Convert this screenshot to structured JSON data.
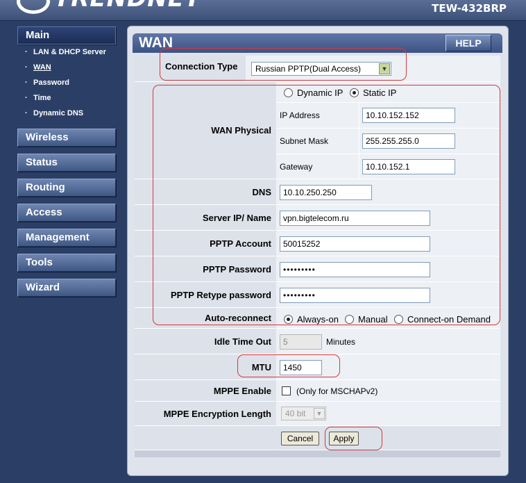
{
  "header": {
    "brand": "TRENDNET",
    "model": "TEW-432BRP"
  },
  "sidebar": {
    "main_label": "Main",
    "sub_items": [
      "LAN & DHCP Server",
      "WAN",
      "Password",
      "Time",
      "Dynamic DNS"
    ],
    "items": [
      "Wireless",
      "Status",
      "Routing",
      "Access",
      "Management",
      "Tools",
      "Wizard"
    ]
  },
  "page": {
    "title": "WAN",
    "help_label": "HELP"
  },
  "form": {
    "connection_type": {
      "label": "Connection Type",
      "value": "Russian PPTP(Dual Access)"
    },
    "wan_physical": {
      "label": "WAN Physical",
      "option_dynamic": "Dynamic IP",
      "option_static": "Static IP",
      "selected": "Static IP",
      "ip_label": "IP Address",
      "ip_value": "10.10.152.152",
      "mask_label": "Subnet Mask",
      "mask_value": "255.255.255.0",
      "gateway_label": "Gateway",
      "gateway_value": "10.10.152.1"
    },
    "dns": {
      "label": "DNS",
      "value": "10.10.250.250"
    },
    "server": {
      "label": "Server IP/ Name",
      "value": "vpn.bigtelecom.ru"
    },
    "pptp_account": {
      "label": "PPTP Account",
      "value": "50015252"
    },
    "pptp_password": {
      "label": "PPTP Password",
      "value": "•••••••••"
    },
    "pptp_retype": {
      "label": "PPTP Retype password",
      "value": "•••••••••"
    },
    "auto_reconnect": {
      "label": "Auto-reconnect",
      "options": [
        "Always-on",
        "Manual",
        "Connect-on Demand"
      ],
      "selected": "Always-on"
    },
    "idle_time": {
      "label": "Idle Time Out",
      "value": "5",
      "unit": "Minutes"
    },
    "mtu": {
      "label": "MTU",
      "value": "1450"
    },
    "mppe_enable": {
      "label": "MPPE Enable",
      "note": "(Only for MSCHAPv2)",
      "checked": false
    },
    "mppe_length": {
      "label": "MPPE Encryption Length",
      "value": "40 bit"
    }
  },
  "actions": {
    "cancel": "Cancel",
    "apply": "Apply"
  },
  "colors": {
    "annotation": "#d23a3a",
    "nav": "#3f5784",
    "panel": "#dfe3eb"
  }
}
